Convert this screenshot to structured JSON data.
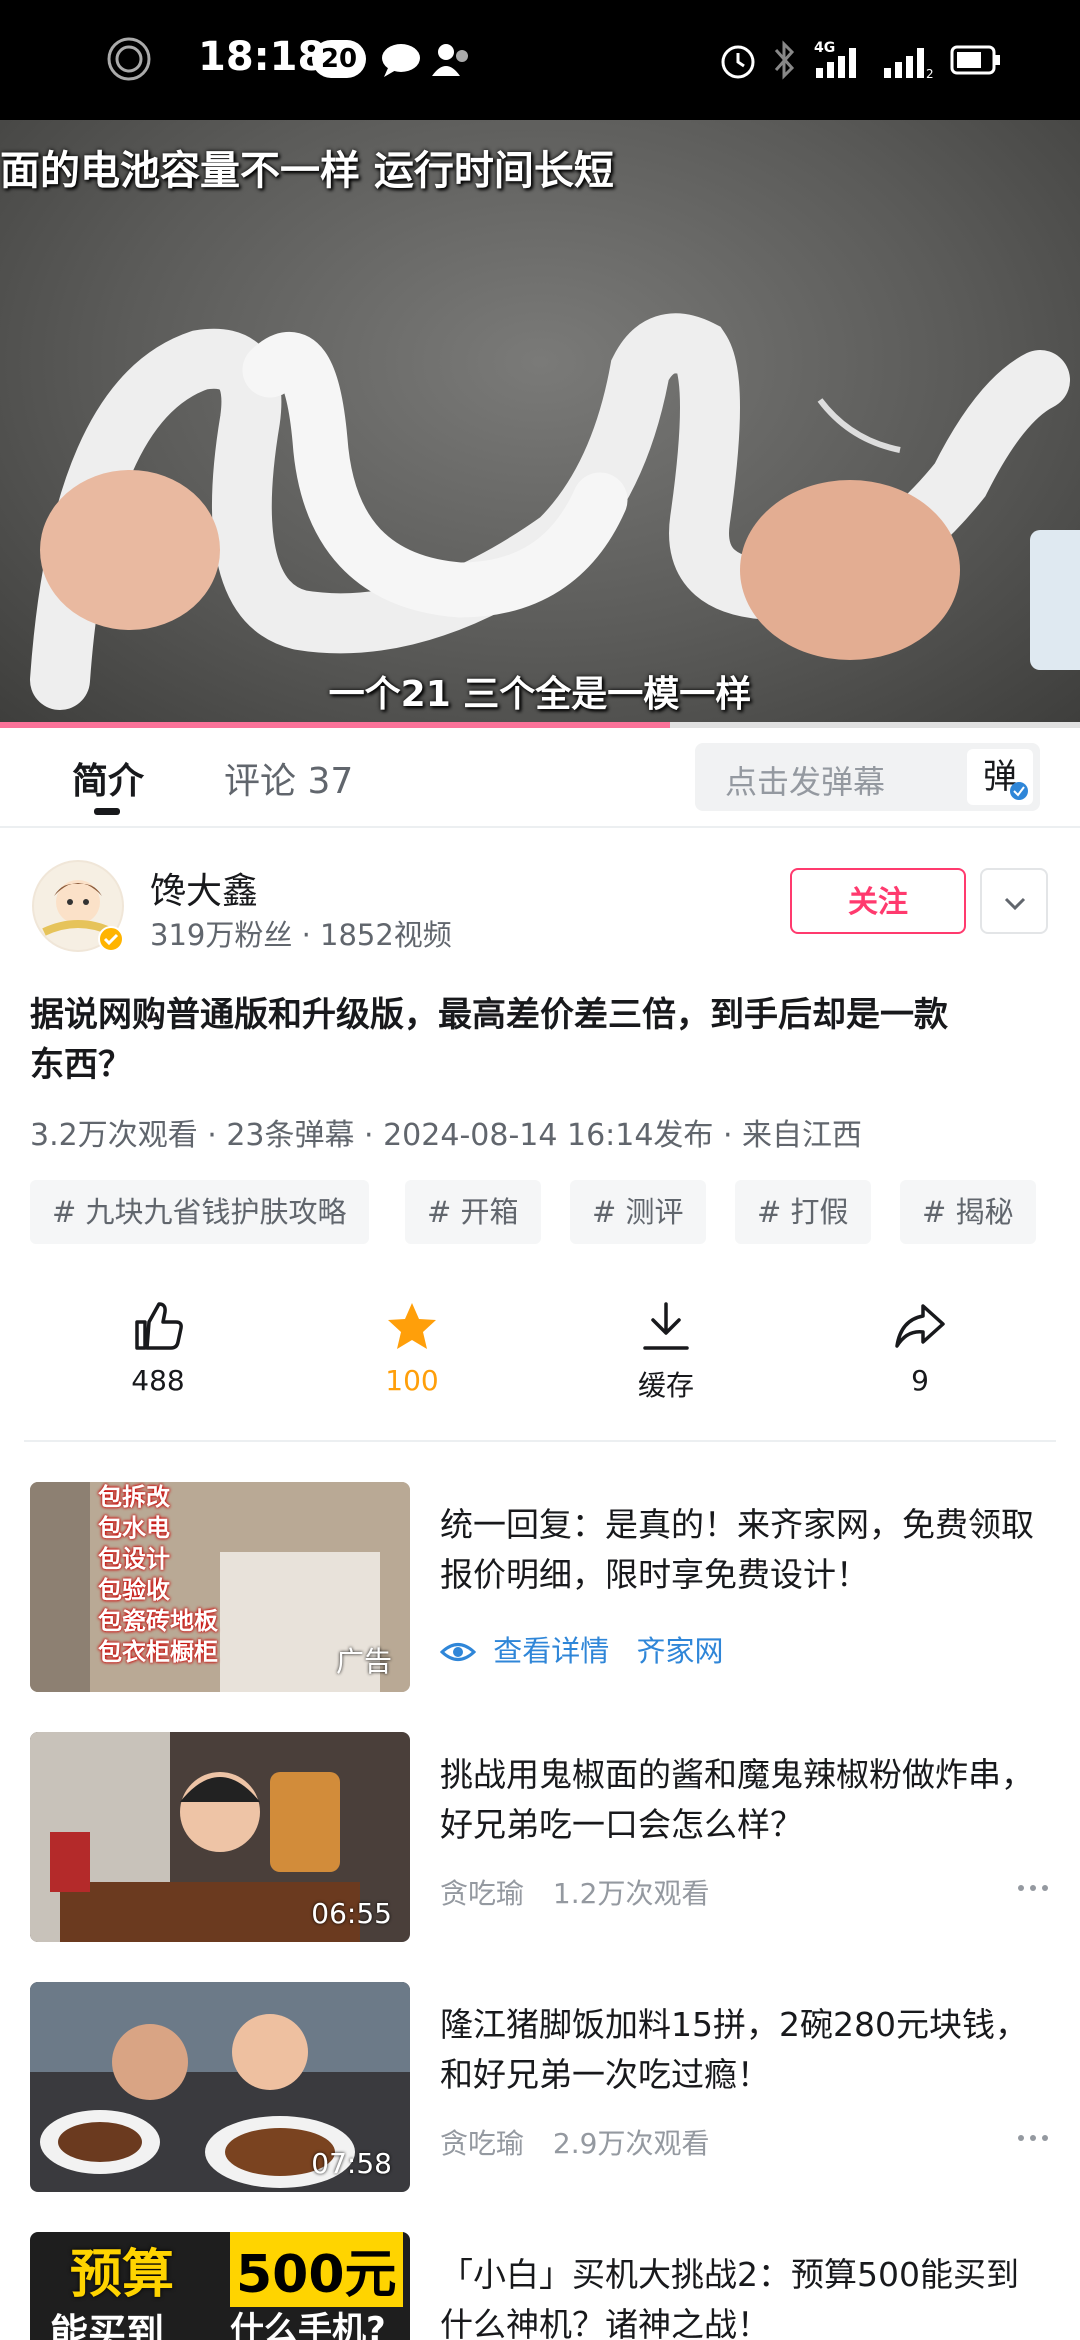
{
  "status_bar": {
    "time": "18:18",
    "notification_count": "20",
    "icons": [
      "record-icon",
      "message-icon",
      "contacts-icon",
      "alarm-icon",
      "bluetooth-icon",
      "signal-4g-icon",
      "signal-icon",
      "battery-icon"
    ]
  },
  "video": {
    "caption_top": "面的电池容量不一样  运行时间长短",
    "caption_bottom": "一个21 三个全是一模一样",
    "progress": 0.62
  },
  "tabs": {
    "intro": "简介",
    "comments": "评论 37"
  },
  "danmaku": {
    "placeholder": "点击发弹幕",
    "button": "弹"
  },
  "uploader": {
    "name": "馋大鑫",
    "meta": "319万粉丝 · 1852视频",
    "follow_label": "关注"
  },
  "video_info": {
    "title": "据说网购普通版和升级版，最高差价差三倍，到手后却是一款东西？",
    "stats": "3.2万次观看 · 23条弹幕 · 2024-08-14 16:14发布 · 来自江西"
  },
  "tags": [
    "# 九块九省钱护肤攻略",
    "# 开箱",
    "# 测评",
    "# 打假",
    "# 揭秘"
  ],
  "actions": {
    "like": "488",
    "favorite": "100",
    "cache": "缓存",
    "share": "9"
  },
  "colors": {
    "accent": "#ff3a6e",
    "favorite": "#ff9f0a",
    "progress": "#fb7299",
    "link": "#2f86d8"
  },
  "recommendations": [
    {
      "title": "统一回复：是真的！来齐家网，免费领取报价明细，限时享免费设计！",
      "badge": "广告",
      "link_label": "查看详情",
      "source": "齐家网",
      "thumb_lines": [
        "包拆改",
        "包水电",
        "包设计",
        "包验收",
        "包瓷砖地板",
        "包衣柜橱柜"
      ]
    },
    {
      "title": "挑战用鬼椒面的酱和魔鬼辣椒粉做炸串，好兄弟吃一口会怎么样？",
      "duration": "06:55",
      "author": "贪吃瑜",
      "views": "1.2万次观看"
    },
    {
      "title": "隆江猪脚饭加料15拼，2碗280元块钱，和好兄弟一次吃过瘾！",
      "duration": "07:58",
      "author": "贪吃瑜",
      "views": "2.9万次观看"
    },
    {
      "title": "「小白」买机大挑战2：预算500能买到什么神机？诸神之战！",
      "thumb_text_1": "预算",
      "thumb_text_2": "500元",
      "thumb_text_3": "能买到",
      "thumb_text_4": "什么手机?"
    }
  ]
}
